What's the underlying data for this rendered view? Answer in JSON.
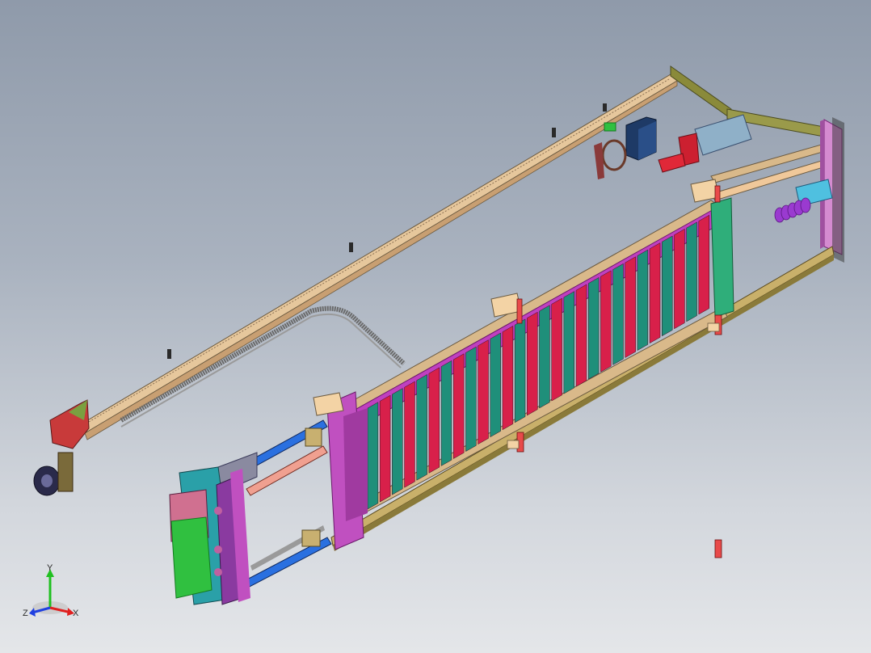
{
  "triad": {
    "x_label": "X",
    "y_label": "Y",
    "z_label": "Z",
    "x_color": "#e02020",
    "y_color": "#20c020",
    "z_color": "#2040e0"
  },
  "colors": {
    "rail_tan": "#d9b98a",
    "rail_olive": "#8a8a3a",
    "frame_magenta": "#c040c0",
    "slat_red": "#d8204a",
    "slat_teal": "#1f8f7a",
    "plate_cyan": "#2aa0a8",
    "plate_green": "#30c040",
    "cable_grey": "#707070",
    "accent_blue": "#2a5acc",
    "motor_navy": "#1e3a66",
    "cylinder_steel": "#7f9cba",
    "spring_purple": "#9a3ad0"
  }
}
